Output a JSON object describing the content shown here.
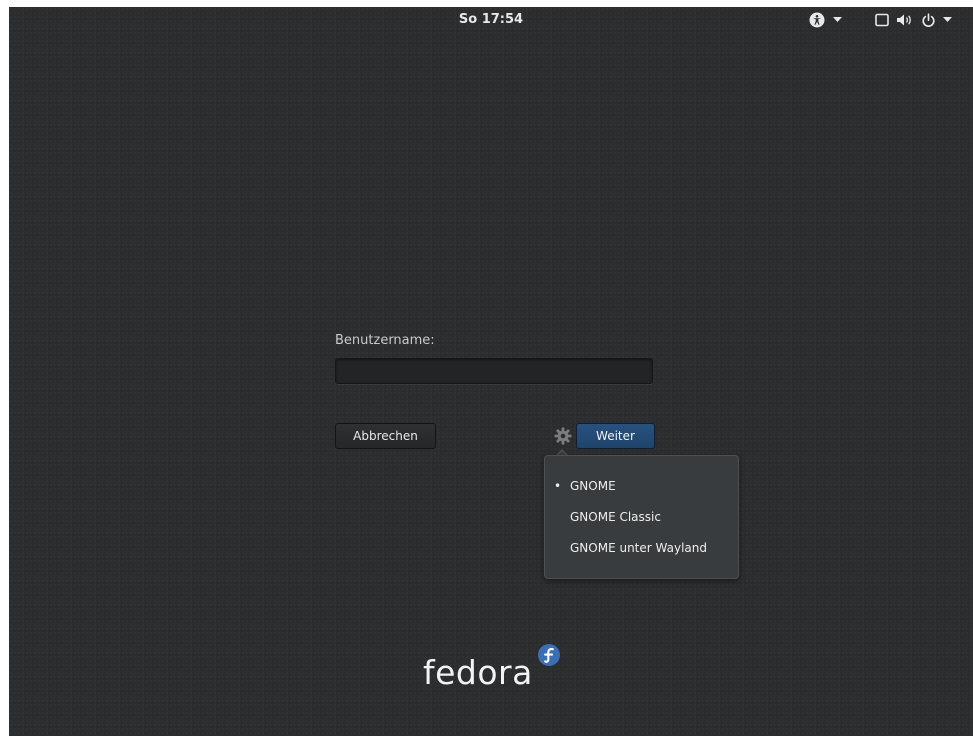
{
  "topbar": {
    "clock": "So 17:54",
    "icons": [
      "accessibility-icon",
      "dropdown-arrow-icon",
      "display-icon",
      "volume-icon",
      "power-icon",
      "dropdown-arrow-icon"
    ]
  },
  "login": {
    "username_label": "Benutzername:",
    "username_value": "",
    "cancel_label": "Abbrechen",
    "next_label": "Weiter",
    "settings_icon": "gear-icon"
  },
  "session_menu": {
    "items": [
      {
        "label": "GNOME",
        "selected": true,
        "marker": "•"
      },
      {
        "label": "GNOME Classic",
        "selected": false,
        "marker": ""
      },
      {
        "label": "GNOME unter Wayland",
        "selected": false,
        "marker": ""
      }
    ]
  },
  "branding": {
    "logo_text": "fedora",
    "logo_mark": "fedora-infinity-icon"
  },
  "colors": {
    "background": "#2b2d2f",
    "accent": "#27527f",
    "menu_bg": "#393c3e",
    "text": "#eeeeee"
  }
}
